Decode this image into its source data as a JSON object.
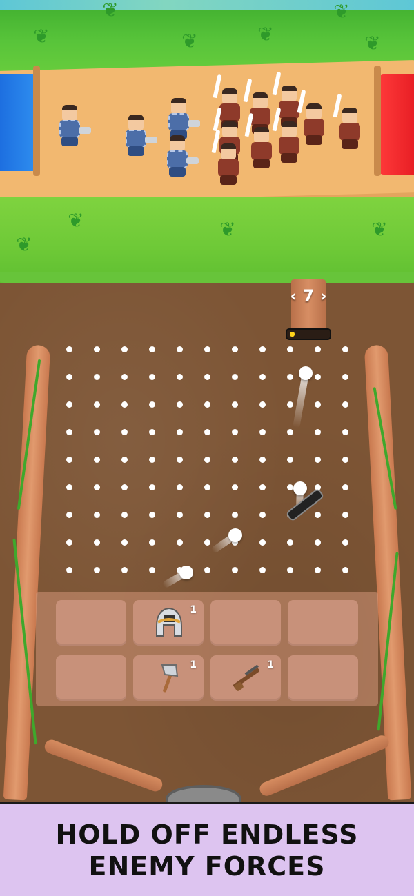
{
  "hud": {
    "drop_count": "7",
    "left_arrow": "‹",
    "right_arrow": "›",
    "power_level": 0.12
  },
  "inventory": {
    "row1": [
      {
        "item": "",
        "count": ""
      },
      {
        "item": "helmet-icon",
        "count": "1"
      },
      {
        "item": "",
        "count": ""
      },
      {
        "item": "",
        "count": ""
      }
    ],
    "row2": [
      {
        "item": "",
        "count": ""
      },
      {
        "item": "axe-icon",
        "count": "1"
      },
      {
        "item": "rifle-icon",
        "count": "1"
      },
      {
        "item": "",
        "count": ""
      }
    ]
  },
  "banner": {
    "line1": "HOLD OFF ENDLESS",
    "line2": "ENEMY FORCES"
  },
  "colors": {
    "team_blue": "#2f8ff0",
    "team_red": "#e81f25",
    "banner_bg": "#ddc4f0"
  }
}
